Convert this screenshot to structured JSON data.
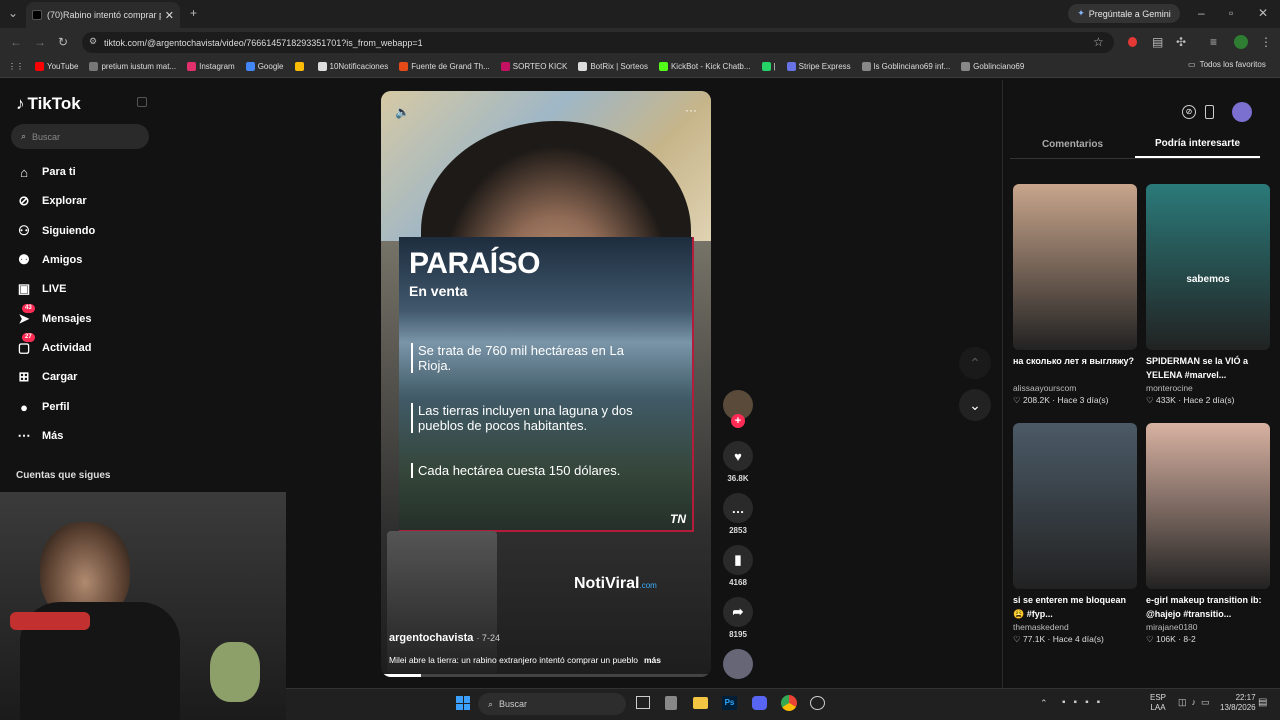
{
  "browser": {
    "tab_title": "(70)Rabino intentó comprar pu",
    "tab_close": "✕",
    "new_tab": "+",
    "gemini_label": "Pregúntale a Gemini",
    "url": "tiktok.com/@argentochavista/video/7666145718293351701?is_from_webapp=1",
    "bookmarks": [
      "YouTube",
      "pretium iustum mat...",
      "Instagram",
      "Google",
      "",
      "10Notificaciones",
      "Fuente de Grand Th...",
      "SORTEO KICK",
      "BotRix | Sorteos",
      "KickBot - Kick Chatb...",
      "|",
      "Stripe Express",
      "ls Goblinciano69 inf...",
      "Goblinciano69"
    ],
    "bookmark_colors": [
      "#ff0000",
      "#777",
      "#e1306c",
      "#4285f4",
      "#fbbc05",
      "#ddd",
      "#e64a19",
      "#c51162",
      "#ddd",
      "#53fc18",
      "#25d366",
      "#6772e5",
      "#888",
      "#888"
    ],
    "all_favorites": "Todos los favoritos"
  },
  "sidebar": {
    "logo": "TikTok",
    "search_placeholder": "Buscar",
    "items": [
      {
        "label": "Para ti",
        "icon": "home-icon",
        "glyph": "⌂"
      },
      {
        "label": "Explorar",
        "icon": "compass-icon",
        "glyph": "⊘"
      },
      {
        "label": "Siguiendo",
        "icon": "following-icon",
        "glyph": "⚇"
      },
      {
        "label": "Amigos",
        "icon": "friends-icon",
        "glyph": "⚉"
      },
      {
        "label": "LIVE",
        "icon": "live-icon",
        "glyph": "▣"
      },
      {
        "label": "Mensajes",
        "icon": "messages-icon",
        "glyph": "➤",
        "badge": "43"
      },
      {
        "label": "Actividad",
        "icon": "activity-icon",
        "glyph": "▢",
        "badge": "27"
      },
      {
        "label": "Cargar",
        "icon": "upload-icon",
        "glyph": "⊞"
      },
      {
        "label": "Perfil",
        "icon": "profile-icon",
        "glyph": "●"
      },
      {
        "label": "Más",
        "icon": "more-icon",
        "glyph": "⋯"
      }
    ],
    "following_title": "Cuentas que sigues"
  },
  "video": {
    "title": "PARAÍSO",
    "subtitle": "En venta",
    "bullets": [
      "Se trata de 760 mil hectáreas en La Rioja.",
      "Las tierras incluyen una laguna y dos pueblos de pocos habitantes.",
      "Cada hectárea cuesta 150 dólares."
    ],
    "tn_logo": "TN",
    "watermark": "NotiViral",
    "watermark_suffix": ".com",
    "username": "argentochavista",
    "date": "· 7-24",
    "caption": "Milei abre la tierra: un rabino extranjero intentó comprar un pueblo",
    "more": "más"
  },
  "actions": {
    "likes": "36.8K",
    "comments": "2853",
    "saves": "4168",
    "shares": "8195"
  },
  "panel": {
    "tab_comments": "Comentarios",
    "tab_interest": "Podría interesarte",
    "cards": [
      {
        "title": "на сколько лет я выгляжу?",
        "author": "alissaayourscom",
        "stats": "♡ 208.2K · Hace 3 día(s)",
        "thumb": "#c9a58c"
      },
      {
        "title": "SPIDERMAN se la VIÓ a YELENA #marvel...",
        "author": "monterocine",
        "stats": "♡ 433K · Hace 2 día(s)",
        "thumb": "#2b7a7a",
        "overlay": "sabemos"
      },
      {
        "title": "si se enteren me bloquean😩 #fyp...",
        "author": "themaskedend",
        "stats": "♡ 77.1K · Hace 4 día(s)",
        "thumb": "#4b5a66"
      },
      {
        "title": "e-girl makeup transition ib: @hajejo #transitio...",
        "author": "mirajane0180",
        "stats": "♡ 106K · 8-2",
        "thumb": "#d8b2a2"
      }
    ]
  },
  "taskbar": {
    "search": "Buscar",
    "lang1": "ESP",
    "lang2": "LAA",
    "time": "22:17",
    "date": "13/8/2026"
  }
}
